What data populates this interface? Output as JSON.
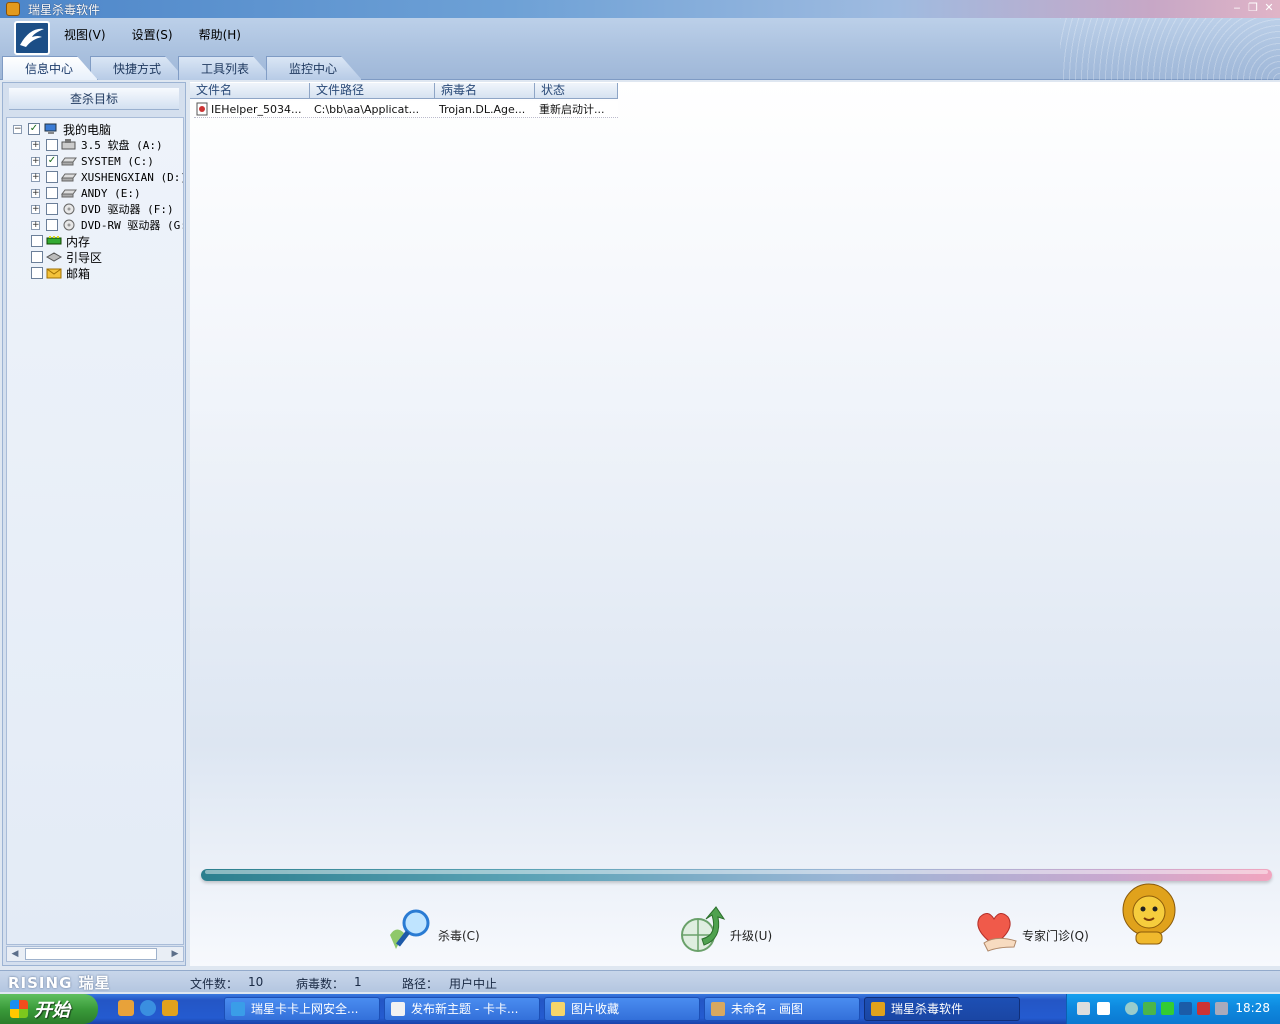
{
  "window": {
    "title": "瑞星杀毒软件"
  },
  "menu": [
    {
      "label": "视图(V)"
    },
    {
      "label": "设置(S)"
    },
    {
      "label": "帮助(H)"
    }
  ],
  "tabs": [
    {
      "label": "信息中心"
    },
    {
      "label": "快捷方式"
    },
    {
      "label": "工具列表"
    },
    {
      "label": "监控中心"
    }
  ],
  "left_panel": {
    "header": "查杀目标",
    "tree": [
      {
        "label": "我的电脑",
        "checked": true
      },
      {
        "label": "3.5 软盘 (A:)",
        "checked": false
      },
      {
        "label": "SYSTEM (C:)",
        "checked": true
      },
      {
        "label": "XUSHENGXIAN (D:)",
        "checked": false
      },
      {
        "label": "ANDY (E:)",
        "checked": false
      },
      {
        "label": "DVD 驱动器 (F:)",
        "checked": false
      },
      {
        "label": "DVD-RW 驱动器 (G:",
        "checked": false
      },
      {
        "label": "内存",
        "checked": false
      },
      {
        "label": "引导区",
        "checked": false
      },
      {
        "label": "邮箱",
        "checked": false
      }
    ]
  },
  "results_table": {
    "columns": [
      "文件名",
      "文件路径",
      "病毒名",
      "状态"
    ],
    "rows": [
      [
        "IEHelper_5034...",
        "C:\\bb\\aa\\Applicat...",
        "Trojan.DL.Age...",
        "重新启动计..."
      ]
    ]
  },
  "progress": {
    "percent": 100
  },
  "actions": {
    "scan": "杀毒(C)",
    "upgrade": "升级(U)",
    "expert": "专家门诊(Q)"
  },
  "status_bar": {
    "brand": "RISING 瑞星",
    "files_label": "文件数：",
    "files_value": "10",
    "virus_label": "病毒数：",
    "virus_value": "1",
    "path_label": "路径：",
    "path_value": "用户中止"
  },
  "taskbar": {
    "start": "开始",
    "items": [
      {
        "label": "瑞星卡卡上网安全..."
      },
      {
        "label": "发布新主题 - 卡卡..."
      },
      {
        "label": "图片收藏"
      },
      {
        "label": "未命名 - 画图"
      },
      {
        "label": "瑞星杀毒软件"
      }
    ],
    "clock": "18:28"
  },
  "colors": {
    "accent": "#245bd0",
    "start_green": "#3a9b3a",
    "progress_start": "#2c7f8e",
    "progress_end": "#f1a5bf"
  }
}
